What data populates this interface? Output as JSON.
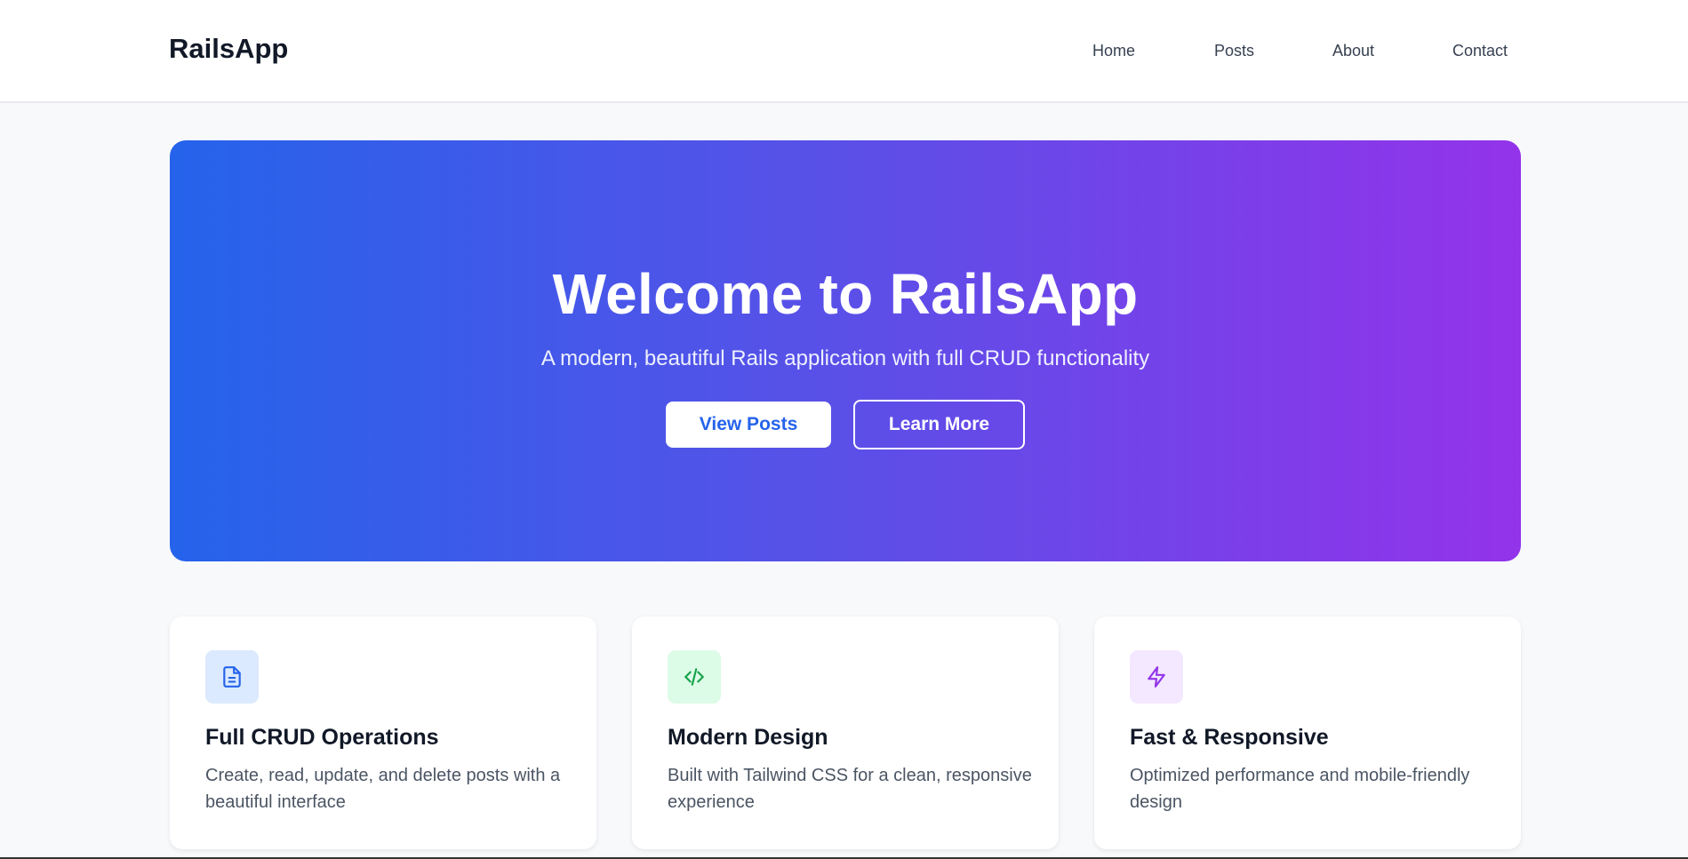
{
  "header": {
    "brand": "RailsApp",
    "nav": {
      "home": "Home",
      "posts": "Posts",
      "about": "About",
      "contact": "Contact"
    }
  },
  "hero": {
    "title": "Welcome to RailsApp",
    "subtitle": "A modern, beautiful Rails application with full CRUD functionality",
    "primary_button": "View Posts",
    "secondary_button": "Learn More",
    "gradient_colors": [
      "#2563eb",
      "#9333ea"
    ]
  },
  "features": [
    {
      "icon": "document-icon",
      "icon_color": "#2563eb",
      "icon_bg": "#dbeafe",
      "title": "Full CRUD Operations",
      "description": "Create, read, update, and delete posts with a beautiful interface"
    },
    {
      "icon": "code-icon",
      "icon_color": "#16a34a",
      "icon_bg": "#dcfce7",
      "title": "Modern Design",
      "description": "Built with Tailwind CSS for a clean, responsive experience"
    },
    {
      "icon": "lightning-icon",
      "icon_color": "#9333ea",
      "icon_bg": "#f3e8ff",
      "title": "Fast & Responsive",
      "description": "Optimized performance and mobile-friendly design"
    }
  ]
}
